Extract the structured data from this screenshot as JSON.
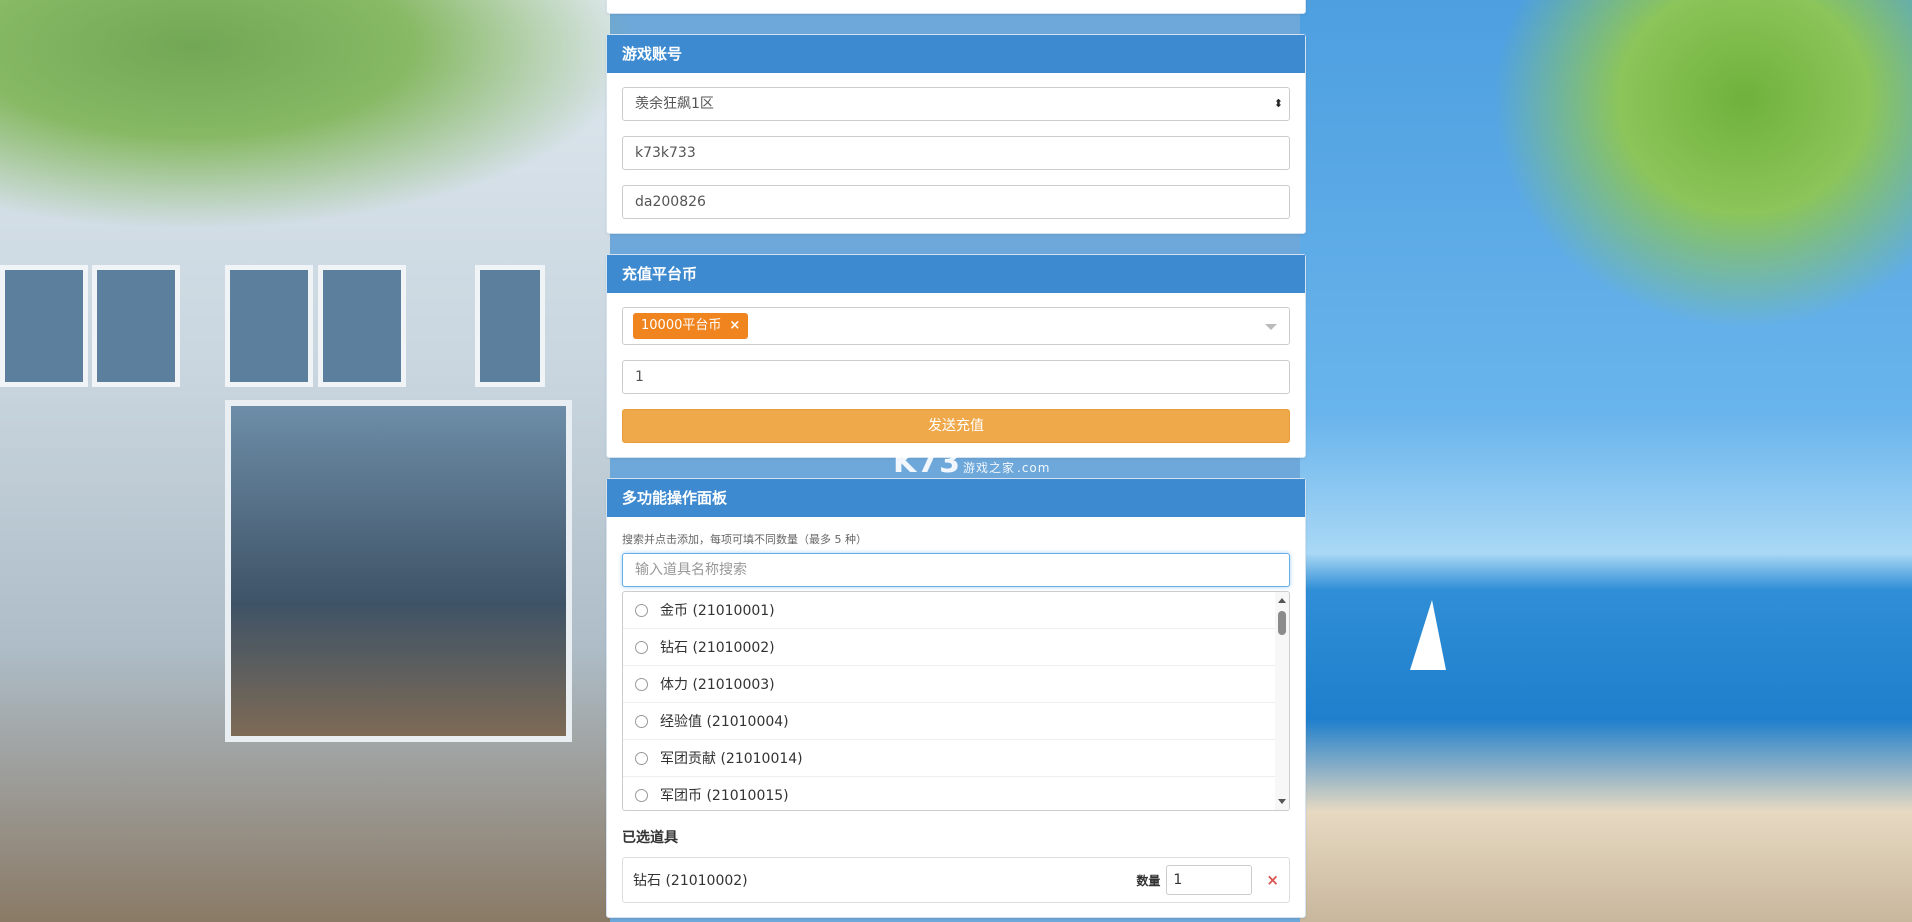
{
  "game_account": {
    "title": "游戏账号",
    "server_select": "羡余狂飙1区",
    "account": "k73k733",
    "role": "da200826"
  },
  "recharge": {
    "title": "充值平台币",
    "selected_tag": "10000平台币",
    "tag_remove": "×",
    "amount": "1",
    "send_button": "发送充值"
  },
  "panel": {
    "title": "多功能操作面板",
    "hint": "搜索并点击添加，每项可填不同数量（最多 5 种）",
    "search_placeholder": "输入道具名称搜索",
    "items": [
      {
        "label": "金币 (21010001)"
      },
      {
        "label": "钻石 (21010002)"
      },
      {
        "label": "体力 (21010003)"
      },
      {
        "label": "经验值 (21010004)"
      },
      {
        "label": "军团贡献 (21010014)"
      },
      {
        "label": "军团币 (21010015)"
      }
    ],
    "selected_title": "已选道具",
    "selected": [
      {
        "name": "钻石 (21010002)",
        "qty_label": "数量",
        "qty": "1",
        "remove": "×"
      }
    ]
  },
  "watermark": {
    "logo": "K73",
    "sub": "游戏之家",
    "domain": ".com"
  },
  "colors": {
    "header": "#3d8ad0",
    "send_button": "#efa84a",
    "tag": "#f0841e",
    "remove": "#d9534f"
  }
}
